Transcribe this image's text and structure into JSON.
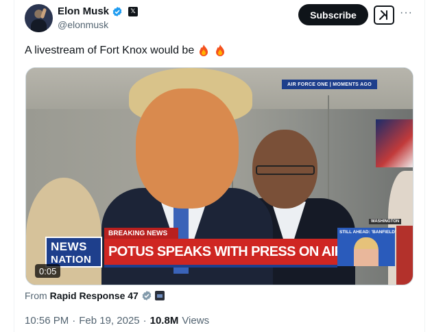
{
  "author": {
    "name": "Elon Musk",
    "handle": "@elonmusk",
    "verified_icon": "verified-badge-icon",
    "affiliation_icon": "x-logo-icon",
    "affiliation_glyph": "𝕏"
  },
  "header": {
    "subscribe_label": "Subscribe",
    "grok_icon": "grok-icon",
    "more_label": "···"
  },
  "tweet": {
    "text": "A livestream of Fort Knox would be",
    "emoji": [
      "fire-emoji",
      "fire-emoji"
    ]
  },
  "media": {
    "duration": "0:05",
    "overlay_top": "AIR FORCE ONE | MOMENTS AGO",
    "breaking_label": "BREAKING NEWS",
    "headline": "POTUS SPEAKS WITH PRESS ON AIR FORCE ONE",
    "network_line1": "NEWS",
    "network_line2": "NATION",
    "still_ahead": "STILL AHEAD: 'BANFIELD'",
    "mini_tag": "WASHINGTON"
  },
  "source": {
    "prefix": "From",
    "name": "Rapid Response 47"
  },
  "meta": {
    "time": "10:56 PM",
    "separator": "·",
    "date": "Feb 19, 2025",
    "views_count": "10.8M",
    "views_label": "Views"
  },
  "colors": {
    "verified_blue": "#1d9bf0",
    "gray_badge": "#829aab",
    "chyron_red": "#cf2622",
    "network_blue": "#1e3f8c"
  }
}
